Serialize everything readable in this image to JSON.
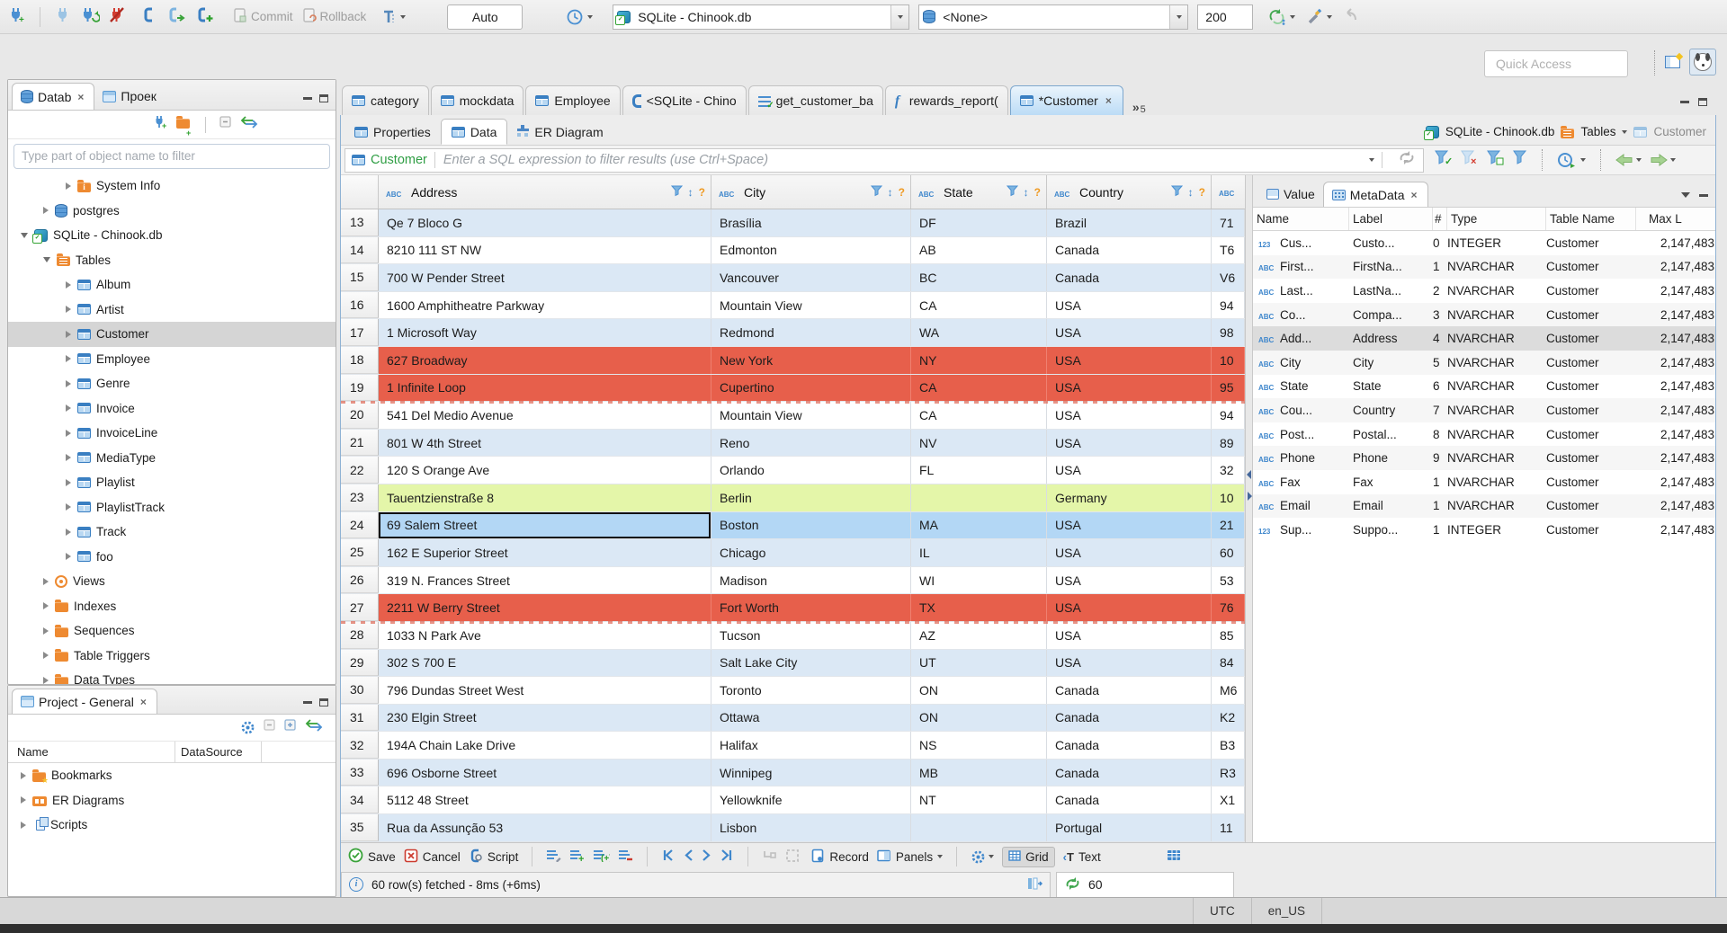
{
  "toolbar": {
    "commit_label": "Commit",
    "rollback_label": "Rollback",
    "auto_label": "Auto",
    "connection_value": "SQLite - Chinook.db",
    "schema_value": "<None>",
    "fetch_size_value": "200",
    "quick_access_placeholder": "Quick Access",
    "icons": [
      "new-connection-plug-icon",
      "plug-icon",
      "reconnect-plug-icon",
      "disconnect-plug-icon",
      "sql-editor-icon",
      "new-sql-editor-icon",
      "open-sql-editor-icon",
      "commit-doc-icon",
      "rollback-doc-icon",
      "transaction-mode-icon",
      "history-clock-icon",
      "database-icon",
      "database-stack-icon",
      "refresh-sync-icon",
      "brush-icon",
      "back-arrow-icon",
      "table-perspective-icon",
      "dbeaver-dog-icon"
    ]
  },
  "sidebar": {
    "tabs": [
      {
        "label": "Datab"
      },
      {
        "label": "Проек"
      }
    ],
    "filter_placeholder": "Type part of object name to filter",
    "tree": [
      {
        "label": "System Info",
        "icon": "i-folder i-folder-info",
        "arrow": "tri-r",
        "cls": "lvl2"
      },
      {
        "label": "postgres",
        "icon": "i-db",
        "arrow": "tri-r",
        "cls": "lvl1"
      },
      {
        "label": "SQLite - Chinook.db",
        "icon": "i-sqlite",
        "arrow": "tri-d",
        "cls": "lvl0"
      },
      {
        "label": "Tables",
        "icon": "i-folder i-folder-table",
        "arrow": "tri-d",
        "cls": "lvl1"
      },
      {
        "label": "Album",
        "icon": "i-table",
        "arrow": "tri-r",
        "cls": "lvl2"
      },
      {
        "label": "Artist",
        "icon": "i-table",
        "arrow": "tri-r",
        "cls": "lvl2"
      },
      {
        "label": "Customer",
        "icon": "i-table",
        "arrow": "tri-r",
        "cls": "lvl2 sel"
      },
      {
        "label": "Employee",
        "icon": "i-table",
        "arrow": "tri-r",
        "cls": "lvl2"
      },
      {
        "label": "Genre",
        "icon": "i-table",
        "arrow": "tri-r",
        "cls": "lvl2"
      },
      {
        "label": "Invoice",
        "icon": "i-table",
        "arrow": "tri-r",
        "cls": "lvl2"
      },
      {
        "label": "InvoiceLine",
        "icon": "i-table",
        "arrow": "tri-r",
        "cls": "lvl2"
      },
      {
        "label": "MediaType",
        "icon": "i-table",
        "arrow": "tri-r",
        "cls": "lvl2"
      },
      {
        "label": "Playlist",
        "icon": "i-table",
        "arrow": "tri-r",
        "cls": "lvl2"
      },
      {
        "label": "PlaylistTrack",
        "icon": "i-table",
        "arrow": "tri-r",
        "cls": "lvl2"
      },
      {
        "label": "Track",
        "icon": "i-table",
        "arrow": "tri-r",
        "cls": "lvl2"
      },
      {
        "label": "foo",
        "icon": "i-table",
        "arrow": "tri-r",
        "cls": "lvl2"
      },
      {
        "label": "Views",
        "icon": "i-eye",
        "arrow": "tri-r",
        "cls": "lvl1"
      },
      {
        "label": "Indexes",
        "icon": "i-folder",
        "arrow": "tri-r",
        "cls": "lvl1"
      },
      {
        "label": "Sequences",
        "icon": "i-folder",
        "arrow": "tri-r",
        "cls": "lvl1"
      },
      {
        "label": "Table Triggers",
        "icon": "i-folder",
        "arrow": "tri-r",
        "cls": "lvl1"
      },
      {
        "label": "Data Types",
        "icon": "i-folder",
        "arrow": "tri-r",
        "cls": "lvl1"
      }
    ],
    "project": {
      "title": "Project - General",
      "columns": [
        "Name",
        "DataSource"
      ],
      "items": [
        {
          "label": "Bookmarks",
          "icon": "i-folder i-folder-star",
          "arrow": "tri-r",
          "cls": "lvl0"
        },
        {
          "label": "ER Diagrams",
          "icon": "i-er",
          "arrow": "tri-r",
          "cls": "lvl0"
        },
        {
          "label": "Scripts",
          "icon": "i-scripts",
          "arrow": "tri-r",
          "cls": "lvl0"
        }
      ]
    }
  },
  "editor": {
    "tabs": [
      {
        "label": "category",
        "icon": "i-table",
        "cls": ""
      },
      {
        "label": "mockdata",
        "icon": "i-table",
        "cls": ""
      },
      {
        "label": "Employee",
        "icon": "i-table",
        "cls": ""
      },
      {
        "label": "<SQLite - Chino",
        "icon": "i-sqltab",
        "cls": ""
      },
      {
        "label": "get_customer_ba",
        "icon": "i-script-check",
        "cls": ""
      },
      {
        "label": "rewards_report(",
        "icon": "i-func",
        "cls": ""
      },
      {
        "label": "*Customer",
        "icon": "i-table",
        "cls": "active"
      }
    ],
    "overflow_count": "5",
    "subtabs": [
      {
        "label": "Properties",
        "icon": "i-table",
        "cls": ""
      },
      {
        "label": "Data",
        "icon": "i-table",
        "cls": "active"
      },
      {
        "label": "ER Diagram",
        "icon": "i-ersub",
        "cls": ""
      }
    ],
    "breadcrumb": {
      "db": "SQLite - Chinook.db",
      "group": "Tables",
      "table": "Customer"
    },
    "filter_table": "Customer",
    "filter_placeholder": "Enter a SQL expression to filter results (use Ctrl+Space)"
  },
  "grid": {
    "headers": [
      "Address",
      "City",
      "State",
      "Country"
    ],
    "partial_header_type": "ABC",
    "rows": [
      {
        "num": "13",
        "cls": "r-blue",
        "cells": [
          "Qe 7 Bloco G",
          "Brasília",
          "DF",
          "Brazil",
          "71"
        ]
      },
      {
        "num": "14",
        "cls": "r-white",
        "cells": [
          "8210 111 ST NW",
          "Edmonton",
          "AB",
          "Canada",
          "T6"
        ]
      },
      {
        "num": "15",
        "cls": "r-blue",
        "cells": [
          "700 W Pender Street",
          "Vancouver",
          "BC",
          "Canada",
          "V6"
        ]
      },
      {
        "num": "16",
        "cls": "r-white",
        "cells": [
          "1600 Amphitheatre Parkway",
          "Mountain View",
          "CA",
          "USA",
          "94"
        ]
      },
      {
        "num": "17",
        "cls": "r-blue",
        "cells": [
          "1 Microsoft Way",
          "Redmond",
          "WA",
          "USA",
          "98"
        ]
      },
      {
        "num": "18",
        "cls": "r-red",
        "cells": [
          "627 Broadway",
          "New York",
          "NY",
          "USA",
          "10"
        ]
      },
      {
        "num": "19",
        "cls": "r-red r-dots",
        "cells": [
          "1 Infinite Loop",
          "Cupertino",
          "CA",
          "USA",
          "95"
        ]
      },
      {
        "num": "20",
        "cls": "r-white",
        "cells": [
          "541 Del Medio Avenue",
          "Mountain View",
          "CA",
          "USA",
          "94"
        ]
      },
      {
        "num": "21",
        "cls": "r-blue",
        "cells": [
          "801 W 4th Street",
          "Reno",
          "NV",
          "USA",
          "89"
        ]
      },
      {
        "num": "22",
        "cls": "r-white",
        "cells": [
          "120 S Orange Ave",
          "Orlando",
          "FL",
          "USA",
          "32"
        ]
      },
      {
        "num": "23",
        "cls": "r-green",
        "cells": [
          "Tauentzienstraße 8",
          "Berlin",
          "",
          "Germany",
          "10"
        ]
      },
      {
        "num": "24",
        "cls": "r-sel",
        "cells": [
          "69 Salem Street",
          "Boston",
          "MA",
          "USA",
          "21"
        ]
      },
      {
        "num": "25",
        "cls": "r-blue",
        "cells": [
          "162 E Superior Street",
          "Chicago",
          "IL",
          "USA",
          "60"
        ]
      },
      {
        "num": "26",
        "cls": "r-white",
        "cells": [
          "319 N. Frances Street",
          "Madison",
          "WI",
          "USA",
          "53"
        ]
      },
      {
        "num": "27",
        "cls": "r-red r-dots",
        "cells": [
          "2211 W Berry Street",
          "Fort Worth",
          "TX",
          "USA",
          "76"
        ]
      },
      {
        "num": "28",
        "cls": "r-white",
        "cells": [
          "1033 N Park Ave",
          "Tucson",
          "AZ",
          "USA",
          "85"
        ]
      },
      {
        "num": "29",
        "cls": "r-blue",
        "cells": [
          "302 S 700 E",
          "Salt Lake City",
          "UT",
          "USA",
          "84"
        ]
      },
      {
        "num": "30",
        "cls": "r-white",
        "cells": [
          "796 Dundas Street West",
          "Toronto",
          "ON",
          "Canada",
          "M6"
        ]
      },
      {
        "num": "31",
        "cls": "r-blue",
        "cells": [
          "230 Elgin Street",
          "Ottawa",
          "ON",
          "Canada",
          "K2"
        ]
      },
      {
        "num": "32",
        "cls": "r-white",
        "cells": [
          "194A Chain Lake Drive",
          "Halifax",
          "NS",
          "Canada",
          "B3"
        ]
      },
      {
        "num": "33",
        "cls": "r-blue",
        "cells": [
          "696 Osborne Street",
          "Winnipeg",
          "MB",
          "Canada",
          "R3"
        ]
      },
      {
        "num": "34",
        "cls": "r-white",
        "cells": [
          "5112 48 Street",
          "Yellowknife",
          "NT",
          "Canada",
          "X1"
        ]
      },
      {
        "num": "35",
        "cls": "r-blue",
        "cells": [
          "Rua da Assunção 53",
          "Lisbon",
          "",
          "Portugal",
          "11"
        ]
      }
    ]
  },
  "panel": {
    "tabs": {
      "value": "Value",
      "metadata": "MetaData"
    },
    "headers": [
      "Name",
      "Label",
      "#",
      "Type",
      "Table Name",
      "Max L"
    ],
    "rows": [
      {
        "icon": "i-123",
        "cls": "",
        "name": "Cus...",
        "label": "Custo...",
        "num": "0",
        "type": "INTEGER",
        "table": "Customer",
        "max": "2,147,483"
      },
      {
        "icon": "i-abc",
        "cls": "",
        "name": "First...",
        "label": "FirstNa...",
        "num": "1",
        "type": "NVARCHAR",
        "table": "Customer",
        "max": "2,147,483"
      },
      {
        "icon": "i-abc",
        "cls": "",
        "name": "Last...",
        "label": "LastNa...",
        "num": "2",
        "type": "NVARCHAR",
        "table": "Customer",
        "max": "2,147,483"
      },
      {
        "icon": "i-abc",
        "cls": "",
        "name": "Co...",
        "label": "Compa...",
        "num": "3",
        "type": "NVARCHAR",
        "table": "Customer",
        "max": "2,147,483"
      },
      {
        "icon": "i-abc",
        "cls": "sel",
        "name": "Add...",
        "label": "Address",
        "num": "4",
        "type": "NVARCHAR",
        "table": "Customer",
        "max": "2,147,483"
      },
      {
        "icon": "i-abc",
        "cls": "",
        "name": "City",
        "label": "City",
        "num": "5",
        "type": "NVARCHAR",
        "table": "Customer",
        "max": "2,147,483"
      },
      {
        "icon": "i-abc",
        "cls": "",
        "name": "State",
        "label": "State",
        "num": "6",
        "type": "NVARCHAR",
        "table": "Customer",
        "max": "2,147,483"
      },
      {
        "icon": "i-abc",
        "cls": "",
        "name": "Cou...",
        "label": "Country",
        "num": "7",
        "type": "NVARCHAR",
        "table": "Customer",
        "max": "2,147,483"
      },
      {
        "icon": "i-abc",
        "cls": "",
        "name": "Post...",
        "label": "Postal...",
        "num": "8",
        "type": "NVARCHAR",
        "table": "Customer",
        "max": "2,147,483"
      },
      {
        "icon": "i-abc",
        "cls": "",
        "name": "Phone",
        "label": "Phone",
        "num": "9",
        "type": "NVARCHAR",
        "table": "Customer",
        "max": "2,147,483"
      },
      {
        "icon": "i-abc",
        "cls": "",
        "name": "Fax",
        "label": "Fax",
        "num": "1",
        "type": "NVARCHAR",
        "table": "Customer",
        "max": "2,147,483"
      },
      {
        "icon": "i-abc",
        "cls": "",
        "name": "Email",
        "label": "Email",
        "num": "1",
        "type": "NVARCHAR",
        "table": "Customer",
        "max": "2,147,483"
      },
      {
        "icon": "i-123",
        "cls": "",
        "name": "Sup...",
        "label": "Suppo...",
        "num": "1",
        "type": "INTEGER",
        "table": "Customer",
        "max": "2,147,483"
      }
    ]
  },
  "footer": {
    "save_label": "Save",
    "cancel_label": "Cancel",
    "script_label": "Script",
    "record_label": "Record",
    "panels_label": "Panels",
    "grid_label": "Grid",
    "text_label": "Text",
    "status_text": "60 row(s) fetched - 8ms (+6ms)",
    "refresh_value": "60",
    "icons": [
      "save-check-icon",
      "cancel-x-icon",
      "script-icon",
      "apply-value-icon",
      "add-row-icon",
      "duplicate-row-icon",
      "delete-row-icon",
      "first-row-icon",
      "prev-row-icon",
      "next-row-icon",
      "last-row-icon",
      "go-to-row-icon",
      "select-region-icon",
      "record-icon",
      "panels-icon",
      "gear-icon",
      "grid-view-icon",
      "text-view-icon",
      "switch-presentation-icon",
      "info-icon",
      "fetch-structure-icon",
      "refresh-icon"
    ]
  },
  "statusbar": {
    "timezone": "UTC",
    "locale": "en_US"
  }
}
